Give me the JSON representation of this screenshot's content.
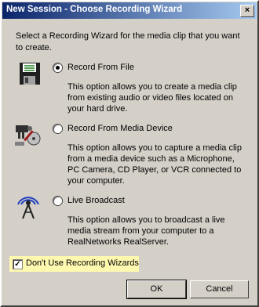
{
  "window": {
    "title": "New Session - Choose Recording Wizard",
    "close_icon": "×"
  },
  "intro": "Select a Recording Wizard for the media clip that you want to create.",
  "options": [
    {
      "label": "Record From File",
      "description": "This option allows you to create a media clip from existing audio or video files located on your hard drive.",
      "selected": true,
      "icon": "floppy-disk-icon"
    },
    {
      "label": "Record From Media Device",
      "description": "This option allows you to capture a media clip from a media device such as a Microphone, PC Camera, CD Player, or VCR connected to your computer.",
      "selected": false,
      "icon": "media-device-icon"
    },
    {
      "label": "Live Broadcast",
      "description": "This option allows you to broadcast a live media stream from your computer to a RealNetworks RealServer.",
      "selected": false,
      "icon": "broadcast-antenna-icon"
    }
  ],
  "checkbox": {
    "label": "Don't Use Recording Wizards",
    "checked": true,
    "check_mark": "✓"
  },
  "buttons": {
    "ok": "OK",
    "cancel": "Cancel"
  }
}
